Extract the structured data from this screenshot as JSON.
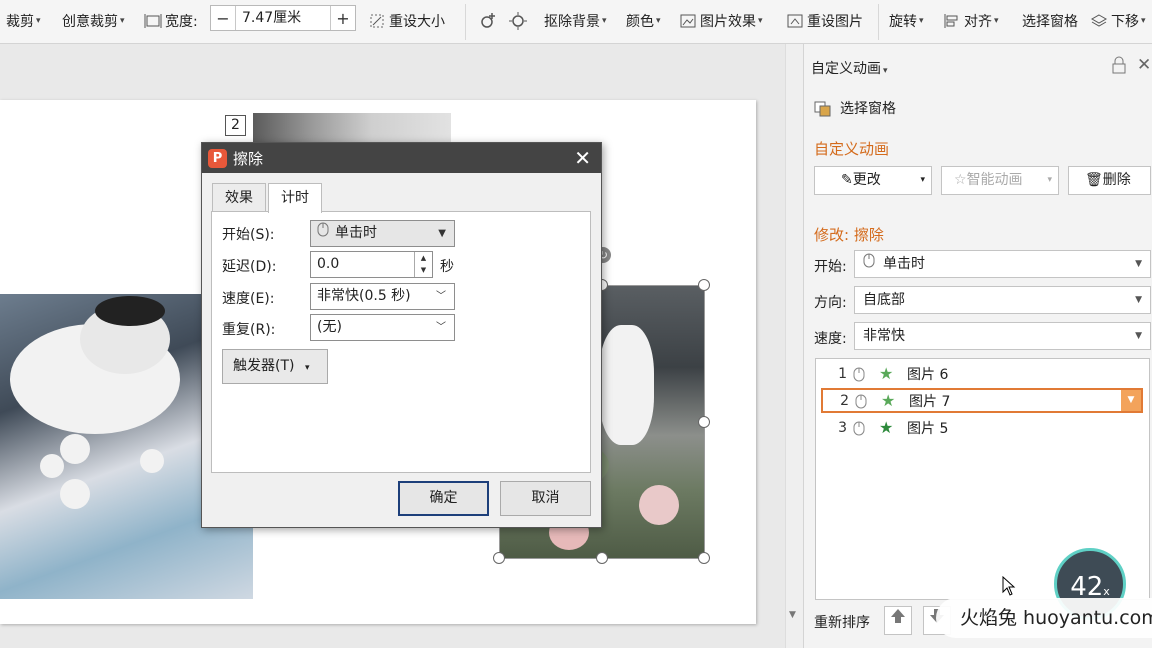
{
  "ribbon": {
    "crop": "裁剪",
    "creative_crop": "创意裁剪",
    "width_label": "宽度:",
    "width_value": "7.47厘米",
    "minus": "−",
    "plus": "+",
    "reset_size": "重设大小",
    "remove_bg": "抠除背景",
    "color": "颜色",
    "picture_effect": "图片效果",
    "reset_picture": "重设图片",
    "rotate": "旋转",
    "align": "对齐",
    "selection_pane": "选择窗格",
    "move_down": "下移"
  },
  "slide": {
    "order_tag": "2"
  },
  "dialog": {
    "title": "擦除",
    "close": "✕",
    "tabs": [
      "效果",
      "计时"
    ],
    "start_label": "开始(S):",
    "start_value": "单击时",
    "delay_label": "延迟(D):",
    "delay_value": "0.0",
    "delay_unit": "秒",
    "speed_label": "速度(E):",
    "speed_value": "非常快(0.5 秒)",
    "repeat_label": "重复(R):",
    "repeat_value": "(无)",
    "trigger_button": "触发器(T)",
    "ok": "确定",
    "cancel": "取消"
  },
  "pane": {
    "title": "自定义动画",
    "selection_pane": "选择窗格",
    "section_title": "自定义动画",
    "change": "更改",
    "smart_anim": "智能动画",
    "delete": "删除",
    "modify_title": "修改: 擦除",
    "start_label": "开始:",
    "start_value": "单击时",
    "direction_label": "方向:",
    "direction_value": "自底部",
    "speed_label": "速度:",
    "speed_value": "非常快",
    "items": [
      {
        "num": "1",
        "name": "图片 6"
      },
      {
        "num": "2",
        "name": "图片 7"
      },
      {
        "num": "3",
        "name": "图片 5"
      }
    ],
    "reorder": "重新排序"
  },
  "overlay": {
    "speed_number": "42",
    "speed_unit": "x",
    "watermark": "火焰兔 huoyantu.com"
  }
}
